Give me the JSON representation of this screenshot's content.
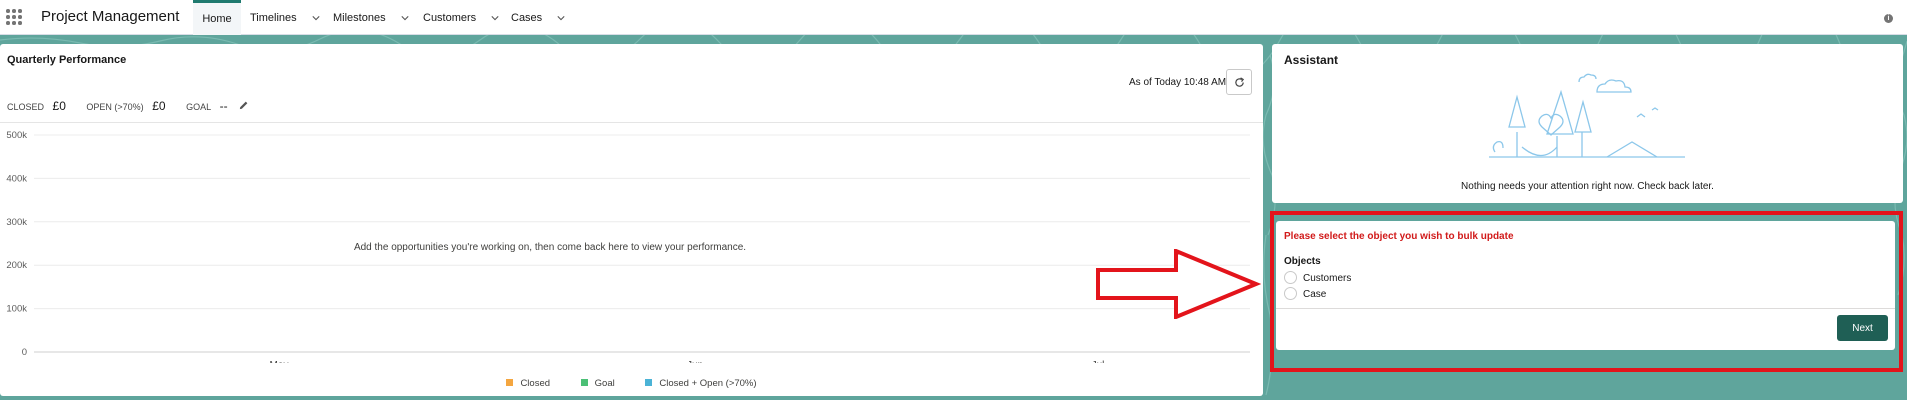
{
  "nav": {
    "app_name": "Project Management",
    "items": [
      {
        "label": "Home",
        "active": true,
        "has_menu": false
      },
      {
        "label": "Timelines",
        "active": false,
        "has_menu": true
      },
      {
        "label": "Milestones",
        "active": false,
        "has_menu": true
      },
      {
        "label": "Customers",
        "active": false,
        "has_menu": true
      },
      {
        "label": "Cases",
        "active": false,
        "has_menu": true
      }
    ],
    "info_icon": "info-icon"
  },
  "performance": {
    "title": "Quarterly Performance",
    "as_of": "As of Today 10:48 AM",
    "closed_label": "CLOSED",
    "closed_value": "£0",
    "open_label": "OPEN (>70%)",
    "open_value": "£0",
    "goal_label": "GOAL",
    "goal_value": "--",
    "empty_message": "Add the opportunities you're working on, then come back here to view your performance."
  },
  "chart_data": {
    "type": "line",
    "title": "",
    "xlabel": "",
    "ylabel": "",
    "categories": [
      "May",
      "Jun",
      "Jul"
    ],
    "y_ticks": [
      "0",
      "100k",
      "200k",
      "300k",
      "400k",
      "500k"
    ],
    "ylim": [
      0,
      500000
    ],
    "grid": true,
    "legend_position": "bottom",
    "series": [
      {
        "name": "Closed",
        "color": "#f4a640",
        "values": []
      },
      {
        "name": "Goal",
        "color": "#4bc076",
        "values": []
      },
      {
        "name": "Closed + Open (>70%)",
        "color": "#4bb3d6",
        "values": []
      }
    ]
  },
  "assistant": {
    "title": "Assistant",
    "message": "Nothing needs your attention right now. Check back later."
  },
  "bulk_update": {
    "prompt": "Please select the object you wish to bulk update",
    "objects_label": "Objects",
    "options": [
      "Customers",
      "Case"
    ],
    "next_label": "Next"
  },
  "colors": {
    "brand_teal": "#1f5f55",
    "background": "#5fa59c",
    "highlight": "#e3141b"
  }
}
